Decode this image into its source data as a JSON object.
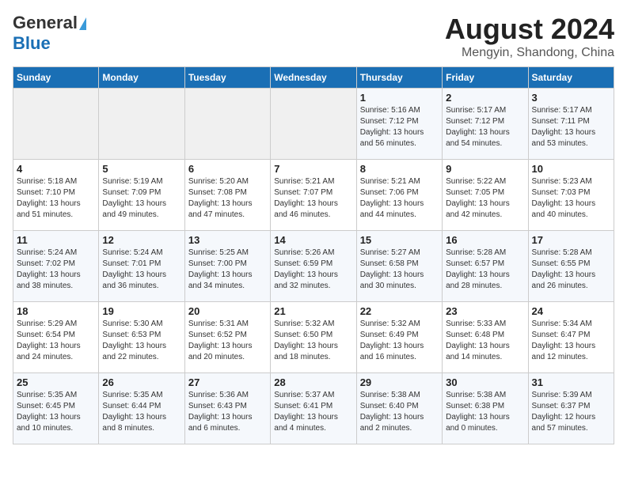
{
  "logo": {
    "part1": "General",
    "part2": "Blue"
  },
  "title": "August 2024",
  "subtitle": "Mengyin, Shandong, China",
  "days_of_week": [
    "Sunday",
    "Monday",
    "Tuesday",
    "Wednesday",
    "Thursday",
    "Friday",
    "Saturday"
  ],
  "weeks": [
    [
      {
        "day": "",
        "content": ""
      },
      {
        "day": "",
        "content": ""
      },
      {
        "day": "",
        "content": ""
      },
      {
        "day": "",
        "content": ""
      },
      {
        "day": "1",
        "content": "Sunrise: 5:16 AM\nSunset: 7:12 PM\nDaylight: 13 hours\nand 56 minutes."
      },
      {
        "day": "2",
        "content": "Sunrise: 5:17 AM\nSunset: 7:12 PM\nDaylight: 13 hours\nand 54 minutes."
      },
      {
        "day": "3",
        "content": "Sunrise: 5:17 AM\nSunset: 7:11 PM\nDaylight: 13 hours\nand 53 minutes."
      }
    ],
    [
      {
        "day": "4",
        "content": "Sunrise: 5:18 AM\nSunset: 7:10 PM\nDaylight: 13 hours\nand 51 minutes."
      },
      {
        "day": "5",
        "content": "Sunrise: 5:19 AM\nSunset: 7:09 PM\nDaylight: 13 hours\nand 49 minutes."
      },
      {
        "day": "6",
        "content": "Sunrise: 5:20 AM\nSunset: 7:08 PM\nDaylight: 13 hours\nand 47 minutes."
      },
      {
        "day": "7",
        "content": "Sunrise: 5:21 AM\nSunset: 7:07 PM\nDaylight: 13 hours\nand 46 minutes."
      },
      {
        "day": "8",
        "content": "Sunrise: 5:21 AM\nSunset: 7:06 PM\nDaylight: 13 hours\nand 44 minutes."
      },
      {
        "day": "9",
        "content": "Sunrise: 5:22 AM\nSunset: 7:05 PM\nDaylight: 13 hours\nand 42 minutes."
      },
      {
        "day": "10",
        "content": "Sunrise: 5:23 AM\nSunset: 7:03 PM\nDaylight: 13 hours\nand 40 minutes."
      }
    ],
    [
      {
        "day": "11",
        "content": "Sunrise: 5:24 AM\nSunset: 7:02 PM\nDaylight: 13 hours\nand 38 minutes."
      },
      {
        "day": "12",
        "content": "Sunrise: 5:24 AM\nSunset: 7:01 PM\nDaylight: 13 hours\nand 36 minutes."
      },
      {
        "day": "13",
        "content": "Sunrise: 5:25 AM\nSunset: 7:00 PM\nDaylight: 13 hours\nand 34 minutes."
      },
      {
        "day": "14",
        "content": "Sunrise: 5:26 AM\nSunset: 6:59 PM\nDaylight: 13 hours\nand 32 minutes."
      },
      {
        "day": "15",
        "content": "Sunrise: 5:27 AM\nSunset: 6:58 PM\nDaylight: 13 hours\nand 30 minutes."
      },
      {
        "day": "16",
        "content": "Sunrise: 5:28 AM\nSunset: 6:57 PM\nDaylight: 13 hours\nand 28 minutes."
      },
      {
        "day": "17",
        "content": "Sunrise: 5:28 AM\nSunset: 6:55 PM\nDaylight: 13 hours\nand 26 minutes."
      }
    ],
    [
      {
        "day": "18",
        "content": "Sunrise: 5:29 AM\nSunset: 6:54 PM\nDaylight: 13 hours\nand 24 minutes."
      },
      {
        "day": "19",
        "content": "Sunrise: 5:30 AM\nSunset: 6:53 PM\nDaylight: 13 hours\nand 22 minutes."
      },
      {
        "day": "20",
        "content": "Sunrise: 5:31 AM\nSunset: 6:52 PM\nDaylight: 13 hours\nand 20 minutes."
      },
      {
        "day": "21",
        "content": "Sunrise: 5:32 AM\nSunset: 6:50 PM\nDaylight: 13 hours\nand 18 minutes."
      },
      {
        "day": "22",
        "content": "Sunrise: 5:32 AM\nSunset: 6:49 PM\nDaylight: 13 hours\nand 16 minutes."
      },
      {
        "day": "23",
        "content": "Sunrise: 5:33 AM\nSunset: 6:48 PM\nDaylight: 13 hours\nand 14 minutes."
      },
      {
        "day": "24",
        "content": "Sunrise: 5:34 AM\nSunset: 6:47 PM\nDaylight: 13 hours\nand 12 minutes."
      }
    ],
    [
      {
        "day": "25",
        "content": "Sunrise: 5:35 AM\nSunset: 6:45 PM\nDaylight: 13 hours\nand 10 minutes."
      },
      {
        "day": "26",
        "content": "Sunrise: 5:35 AM\nSunset: 6:44 PM\nDaylight: 13 hours\nand 8 minutes."
      },
      {
        "day": "27",
        "content": "Sunrise: 5:36 AM\nSunset: 6:43 PM\nDaylight: 13 hours\nand 6 minutes."
      },
      {
        "day": "28",
        "content": "Sunrise: 5:37 AM\nSunset: 6:41 PM\nDaylight: 13 hours\nand 4 minutes."
      },
      {
        "day": "29",
        "content": "Sunrise: 5:38 AM\nSunset: 6:40 PM\nDaylight: 13 hours\nand 2 minutes."
      },
      {
        "day": "30",
        "content": "Sunrise: 5:38 AM\nSunset: 6:38 PM\nDaylight: 13 hours\nand 0 minutes."
      },
      {
        "day": "31",
        "content": "Sunrise: 5:39 AM\nSunset: 6:37 PM\nDaylight: 12 hours\nand 57 minutes."
      }
    ]
  ]
}
